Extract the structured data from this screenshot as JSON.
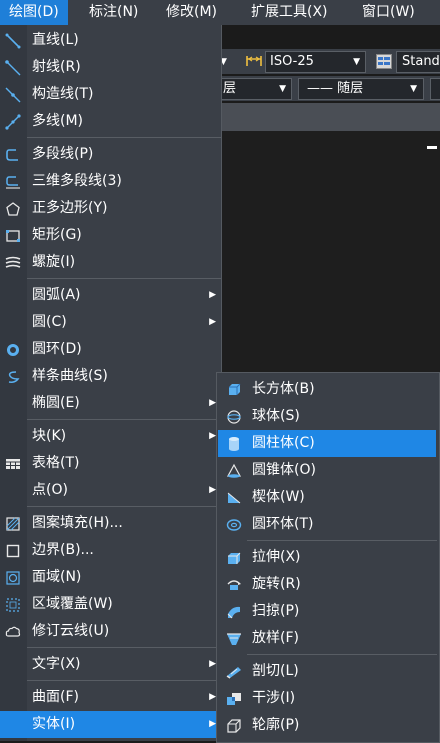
{
  "menubar": {
    "items": [
      {
        "label": "绘图(D)",
        "active": true
      },
      {
        "label": "标注(N)"
      },
      {
        "label": "修改(M)"
      },
      {
        "label": "扩展工具(X)"
      },
      {
        "label": "窗口(W)"
      }
    ]
  },
  "toolbar": {
    "dimstyle": "ISO-25",
    "textstyle": "Stand",
    "layer_partial": "层",
    "linetype": "—— 随层"
  },
  "draw_menu": {
    "items": [
      {
        "label": "直线(L)",
        "icon": "line-icon"
      },
      {
        "label": "射线(R)",
        "icon": "ray-icon"
      },
      {
        "label": "构造线(T)",
        "icon": "construction-line-icon"
      },
      {
        "label": "多线(M)",
        "icon": "multiline-icon"
      },
      {
        "label": "多段线(P)",
        "icon": "polyline-icon"
      },
      {
        "label": "三维多段线(3)",
        "icon": "3d-polyline-icon"
      },
      {
        "label": "正多边形(Y)",
        "icon": "polygon-icon"
      },
      {
        "label": "矩形(G)",
        "icon": "rectangle-icon"
      },
      {
        "label": "螺旋(I)",
        "icon": "helix-icon"
      },
      {
        "label": "圆弧(A)",
        "icon": "",
        "submenu": true
      },
      {
        "label": "圆(C)",
        "icon": "",
        "submenu": true
      },
      {
        "label": "圆环(D)",
        "icon": "donut-icon"
      },
      {
        "label": "样条曲线(S)",
        "icon": "spline-icon"
      },
      {
        "label": "椭圆(E)",
        "icon": "",
        "submenu": true
      },
      {
        "label": "块(K)",
        "icon": "",
        "submenu": true
      },
      {
        "label": "表格(T)",
        "icon": "table-icon"
      },
      {
        "label": "点(O)",
        "icon": "",
        "submenu": true
      },
      {
        "label": "图案填充(H)...",
        "icon": "hatch-icon"
      },
      {
        "label": "边界(B)...",
        "icon": "boundary-icon"
      },
      {
        "label": "面域(N)",
        "icon": "region-icon"
      },
      {
        "label": "区域覆盖(W)",
        "icon": "wipeout-icon"
      },
      {
        "label": "修订云线(U)",
        "icon": "revcloud-icon"
      },
      {
        "label": "文字(X)",
        "icon": "",
        "submenu": true
      },
      {
        "label": "曲面(F)",
        "icon": "",
        "submenu": true
      },
      {
        "label": "实体(I)",
        "icon": "",
        "submenu": true,
        "active": true
      }
    ]
  },
  "solid_submenu": {
    "items": [
      {
        "label": "长方体(B)",
        "icon": "box-icon"
      },
      {
        "label": "球体(S)",
        "icon": "sphere-icon"
      },
      {
        "label": "圆柱体(C)",
        "icon": "cylinder-icon",
        "active": true
      },
      {
        "label": "圆锥体(O)",
        "icon": "cone-icon"
      },
      {
        "label": "楔体(W)",
        "icon": "wedge-icon"
      },
      {
        "label": "圆环体(T)",
        "icon": "torus-icon"
      },
      {
        "label": "拉伸(X)",
        "icon": "extrude-icon"
      },
      {
        "label": "旋转(R)",
        "icon": "revolve-icon"
      },
      {
        "label": "扫掠(P)",
        "icon": "sweep-icon"
      },
      {
        "label": "放样(F)",
        "icon": "loft-icon"
      },
      {
        "label": "剖切(L)",
        "icon": "slice-icon"
      },
      {
        "label": "干涉(I)",
        "icon": "interfere-icon"
      },
      {
        "label": "轮廓(P)",
        "icon": "solprof-icon"
      }
    ]
  },
  "colors": {
    "menu_bg": "#3a3f47",
    "highlight": "#1f87e5",
    "icon_blue": "#5ab0f0"
  }
}
